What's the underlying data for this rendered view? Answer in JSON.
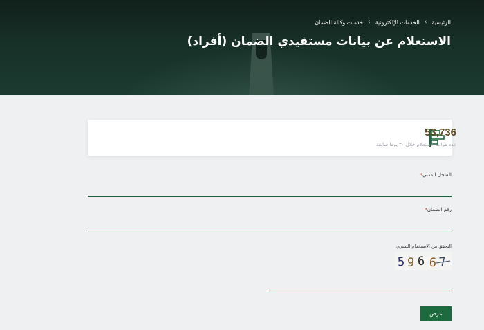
{
  "breadcrumb": {
    "items": [
      "الرئيسية",
      "الخدمات الإلكترونية",
      "خدمات وكالة الضمان"
    ],
    "separator": "›"
  },
  "page": {
    "title": "الاستعلام عن بيانات مستفيدي الضمان (أفراد)"
  },
  "stats": {
    "value": "53,736",
    "caption": "عدد مرات الاستعلام خلال ٣٠ يوما سابقة",
    "icon": "bar-chart-icon"
  },
  "form": {
    "civil_id": {
      "label": "السجل المدني",
      "required_mark": "*",
      "value": ""
    },
    "guarantee_no": {
      "label": "رقم الضمان",
      "required_mark": "*",
      "value": ""
    },
    "captcha": {
      "label": "التحقق من الاستخدام البشري",
      "code": "59667",
      "value": ""
    },
    "submit_label": "عرض"
  },
  "colors": {
    "primary": "#1d6a3e",
    "hero": "#173028",
    "stat_value": "#5a4820"
  }
}
